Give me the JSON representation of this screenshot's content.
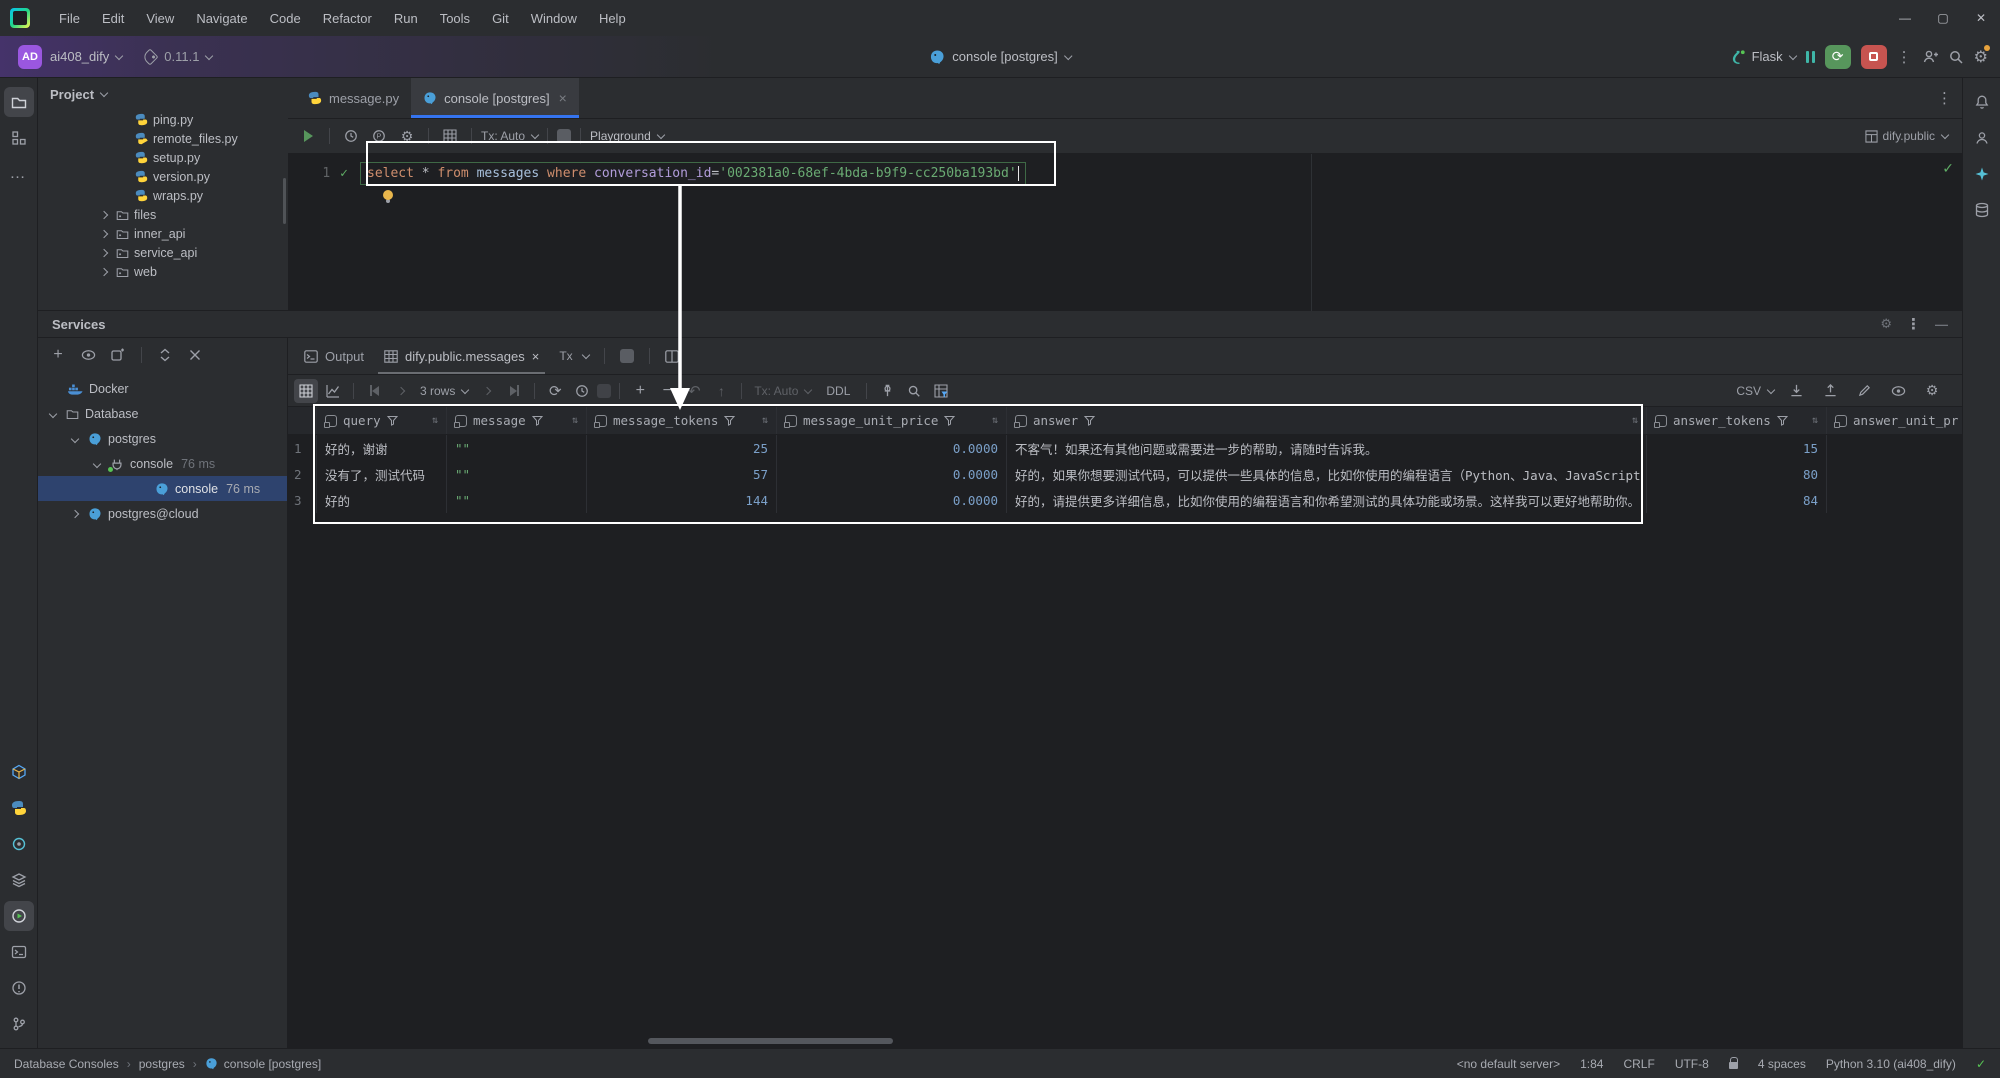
{
  "colors": {
    "accent": "#3574f0",
    "run_green": "#57965c",
    "stop_red": "#c75450",
    "string_green": "#6aab73",
    "keyword_orange": "#cf8e6d",
    "selection_blue": "#2e436e",
    "badge_purple": "#9a57e0",
    "annotation_white": "#ffffff"
  },
  "menu": {
    "items": [
      "File",
      "Edit",
      "View",
      "Navigate",
      "Code",
      "Refactor",
      "Run",
      "Tools",
      "Git",
      "Window",
      "Help"
    ]
  },
  "window_controls": {
    "minimize": "—",
    "maximize": "▢",
    "close": "✕"
  },
  "toolbar": {
    "badge": "AD",
    "project": "ai408_dify",
    "version": "0.11.1",
    "target": "console [postgres]",
    "run_config": "Flask"
  },
  "project_panel": {
    "title": "Project",
    "files": [
      {
        "label": "ping.py"
      },
      {
        "label": "remote_files.py"
      },
      {
        "label": "setup.py"
      },
      {
        "label": "version.py"
      },
      {
        "label": "wraps.py"
      }
    ],
    "folders": [
      {
        "label": "files"
      },
      {
        "label": "inner_api"
      },
      {
        "label": "service_api"
      },
      {
        "label": "web"
      }
    ]
  },
  "editor": {
    "tabs": [
      {
        "label": "message.py"
      },
      {
        "label": "console [postgres]"
      }
    ],
    "tx_mode": "Tx: Auto",
    "playground": "Playground",
    "schema": "dify.public",
    "line_number": "1",
    "sql": {
      "kw_select": "select",
      "star": "*",
      "kw_from": "from",
      "table": "messages",
      "kw_where": "where",
      "column": "conversation_id",
      "eq": "=",
      "value": "'002381a0-68ef-4bda-b9f9-cc250ba193bd'"
    }
  },
  "services": {
    "title": "Services",
    "nodes": [
      {
        "label": "Docker",
        "time": ""
      },
      {
        "label": "Database",
        "time": ""
      },
      {
        "label": "postgres",
        "time": ""
      },
      {
        "label": "console",
        "time": "76 ms"
      },
      {
        "label": "console",
        "time": "76 ms"
      },
      {
        "label": "postgres@cloud",
        "time": ""
      }
    ]
  },
  "results": {
    "tab_output": "Output",
    "tab_result": "dify.public.messages",
    "tx_badge": "Tx",
    "toolbar": {
      "rows": "3 rows",
      "tx": "Tx: Auto",
      "ddl": "DDL",
      "csv": "CSV"
    },
    "grid": {
      "columns": [
        {
          "label": "query"
        },
        {
          "label": "message"
        },
        {
          "label": "message_tokens"
        },
        {
          "label": "message_unit_price"
        },
        {
          "label": "answer"
        },
        {
          "label": "answer_tokens"
        },
        {
          "label": "answer_unit_pr"
        }
      ],
      "rows": [
        {
          "num": "1",
          "query": "好的，谢谢",
          "message": "\"\"",
          "message_tokens": "25",
          "message_unit_price": "0.0000",
          "answer": "不客气！如果还有其他问题或需要进一步的帮助，请随时告诉我。",
          "answer_tokens": "15",
          "answer_unit_price": ""
        },
        {
          "num": "2",
          "query": "没有了，测试代码",
          "message": "\"\"",
          "message_tokens": "57",
          "message_unit_price": "0.0000",
          "answer": "好的，如果你想要测试代码，可以提供一些具体的信息，比如你使用的编程语言（Python、Java、JavaScript",
          "answer_tokens": "80",
          "answer_unit_price": ""
        },
        {
          "num": "3",
          "query": "好的",
          "message": "\"\"",
          "message_tokens": "144",
          "message_unit_price": "0.0000",
          "answer": "好的，请提供更多详细信息，比如你使用的编程语言和你希望测试的具体功能或场景。这样我可以更好地帮助你。",
          "answer_tokens": "84",
          "answer_unit_price": ""
        }
      ]
    }
  },
  "status_bar": {
    "breadcrumb": [
      "Database Consoles",
      "postgres",
      "console [postgres]"
    ],
    "no_default_server": "<no default server>",
    "caret": "1:84",
    "line_ending": "CRLF",
    "encoding": "UTF-8",
    "indent": "4 spaces",
    "interpreter": "Python 3.10 (ai408_dify)"
  }
}
